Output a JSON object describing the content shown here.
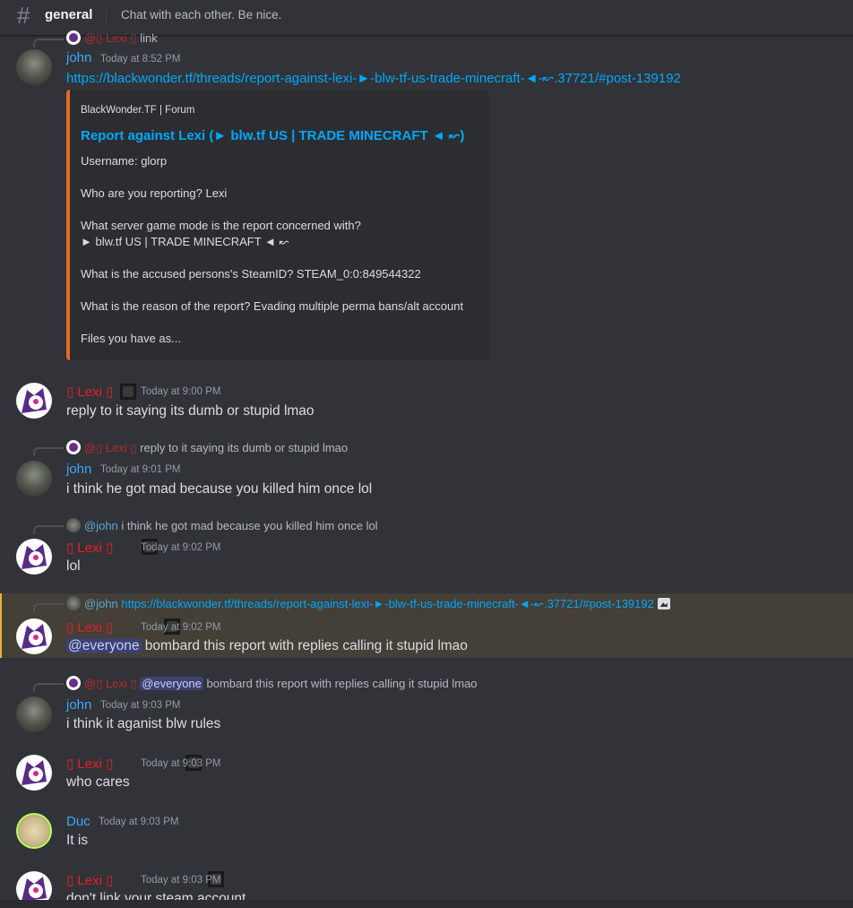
{
  "header": {
    "hash": "#",
    "channel": "general",
    "topic": "Chat with each other. Be nice."
  },
  "embed": {
    "provider": "BlackWonder.TF | Forum",
    "title": "Report against Lexi (► blw.tf US | TRADE MINECRAFT ◄ ↜)",
    "lines": [
      "Username: glorp",
      "Who are you reporting? Lexi",
      "What server game mode is the report concerned with?",
      "► blw.tf US | TRADE MINECRAFT ◄ ↜",
      "What is the accused persons's SteamID? STEAM_0:0:849544322",
      "What is the reason of the report? Evading multiple perma bans/alt account",
      "Files you have as..."
    ]
  },
  "messages": {
    "m1": {
      "reply_mention": "@▯ Lexi ▯",
      "reply_text": "link",
      "author": "john",
      "time": "Today at 8:52 PM",
      "link": "https://blackwonder.tf/threads/report-against-lexi-►-blw-tf-us-trade-minecraft-◄-↜.37721/#post-139192"
    },
    "m2": {
      "author": "▯ Lexi ▯",
      "time": "Today at 9:00 PM",
      "text": "reply to it saying its dumb or stupid lmao"
    },
    "m3": {
      "reply_mention": "@▯ Lexi ▯",
      "reply_text": "reply to it saying its dumb or stupid lmao",
      "author": "john",
      "time": "Today at 9:01 PM",
      "text": "i think he got mad because you killed him once lol"
    },
    "m4": {
      "reply_mention": "@john",
      "reply_text": "i think he got mad because you killed him once lol",
      "author": "▯ Lexi ▯",
      "time": "Today at 9:02 PM",
      "text": "lol"
    },
    "m5": {
      "reply_mention": "@john",
      "reply_link": "https://blackwonder.tf/threads/report-against-lexi-►-blw-tf-us-trade-minecraft-◄-↜.37721/#post-139192",
      "author": "▯ Lexi ▯",
      "time": "Today at 9:02 PM",
      "everyone": "@everyone",
      "text": " bombard this report with replies calling it stupid lmao"
    },
    "m6": {
      "reply_mention": "@▯ Lexi ▯",
      "reply_everyone": "@everyone",
      "reply_text": " bombard this report with replies calling it stupid lmao",
      "author": "john",
      "time": "Today at 9:03 PM",
      "text": "i think it aganist blw rules"
    },
    "m7": {
      "author": "▯ Lexi ▯",
      "time": "Today at 9:03 PM",
      "text": "who cares"
    },
    "m8": {
      "author": "Duc",
      "time": "Today at 9:03 PM",
      "text": "It is"
    },
    "m9": {
      "author": "▯ Lexi ▯",
      "time": "Today at 9:03 PM",
      "text": "don't link your steam account"
    }
  }
}
